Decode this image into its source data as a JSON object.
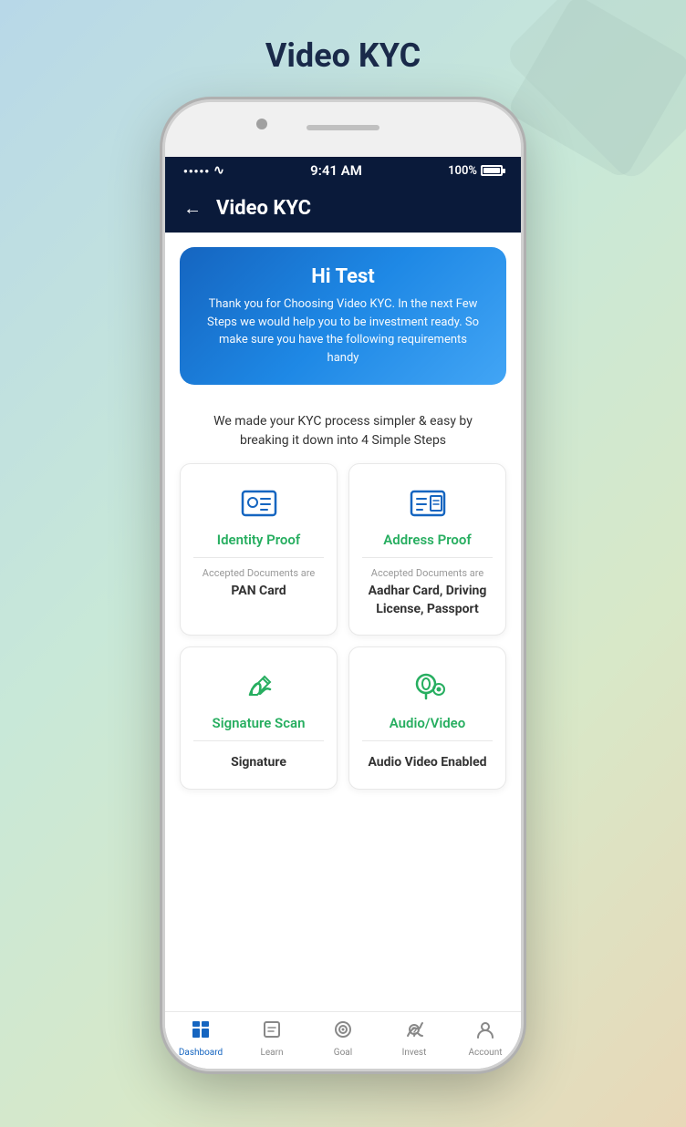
{
  "page": {
    "title": "Video KYC"
  },
  "status_bar": {
    "signal": "●●●●●",
    "wifi": "WiFi",
    "time": "9:41 AM",
    "battery": "100%"
  },
  "nav": {
    "back_label": "←",
    "title": "Video KYC"
  },
  "banner": {
    "greeting": "Hi Test",
    "description": "Thank you for Choosing Video KYC. In the next Few Steps we would help you to be investment ready. So make sure you have the following requirements handy"
  },
  "steps_info": "We made your KYC process simpler & easy by breaking it down into 4 Simple Steps",
  "cards": [
    {
      "id": "identity-proof",
      "title": "Identity Proof",
      "accepted_label": "Accepted Documents are",
      "documents": "PAN Card",
      "icon": "identity"
    },
    {
      "id": "address-proof",
      "title": "Address Proof",
      "accepted_label": "Accepted Documents are",
      "documents": "Aadhar Card, Driving License, Passport",
      "icon": "address"
    },
    {
      "id": "signature-scan",
      "title": "Signature Scan",
      "accepted_label": "",
      "documents": "Signature",
      "icon": "signature"
    },
    {
      "id": "audio-video",
      "title": "Audio/Video",
      "accepted_label": "",
      "documents": "Audio Video Enabled",
      "icon": "audio-video"
    }
  ],
  "tabs": [
    {
      "id": "dashboard",
      "label": "Dashboard",
      "icon": "dashboard",
      "active": true
    },
    {
      "id": "learn",
      "label": "Learn",
      "icon": "learn",
      "active": false
    },
    {
      "id": "goal",
      "label": "Goal",
      "icon": "goal",
      "active": false
    },
    {
      "id": "invest",
      "label": "Invest",
      "icon": "invest",
      "active": false
    },
    {
      "id": "account",
      "label": "Account",
      "icon": "account",
      "active": false
    }
  ]
}
